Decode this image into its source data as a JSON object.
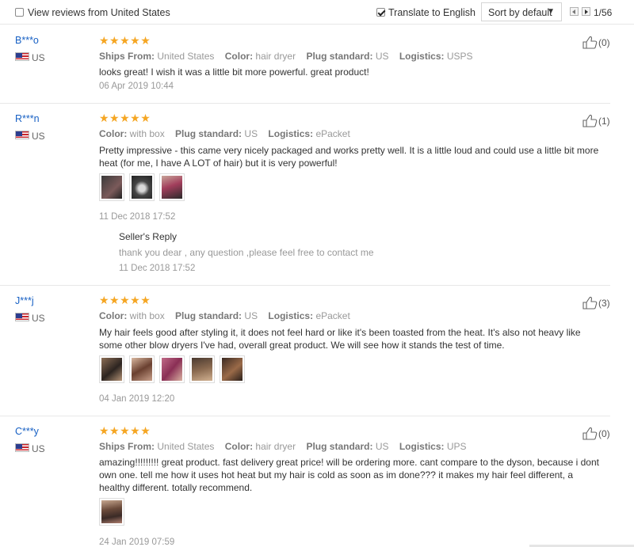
{
  "toolbar": {
    "view_us_label": "View reviews from United States",
    "view_us_checked": false,
    "translate_label": "Translate to English",
    "translate_checked": true,
    "sort_label": "Sort by default",
    "page": "1/56"
  },
  "reviews": [
    {
      "user": "B***o",
      "country": "US",
      "stars": "★★★★★",
      "attrs": [
        {
          "k": "Ships From:",
          "v": "United States"
        },
        {
          "k": "Color:",
          "v": "hair dryer"
        },
        {
          "k": "Plug standard:",
          "v": "US"
        },
        {
          "k": "Logistics:",
          "v": "USPS"
        }
      ],
      "content": "looks great! I wish it was a little bit more powerful. great product!",
      "date": "06 Apr 2019 10:44",
      "likes": "(0)"
    },
    {
      "user": "R***n",
      "country": "US",
      "stars": "★★★★★",
      "attrs": [
        {
          "k": "Color:",
          "v": "with box"
        },
        {
          "k": "Plug standard:",
          "v": "US"
        },
        {
          "k": "Logistics:",
          "v": "ePacket"
        }
      ],
      "content": "Pretty impressive - this came very nicely packaged and works pretty well. It is a little loud and could use a little bit more heat (for me, I have A LOT of hair) but it is very powerful!",
      "date": "11 Dec 2018 17:52",
      "likes": "(1)",
      "reply": {
        "title": "Seller's Reply",
        "text": "thank you dear , any question ,please feel free to contact me",
        "date": "11 Dec 2018 17:52"
      }
    },
    {
      "user": "J***j",
      "country": "US",
      "stars": "★★★★★",
      "attrs": [
        {
          "k": "Color:",
          "v": "with box"
        },
        {
          "k": "Plug standard:",
          "v": "US"
        },
        {
          "k": "Logistics:",
          "v": "ePacket"
        }
      ],
      "content": "My hair feels good after styling it, it does not feel hard or like it's been toasted from the heat. It's also not heavy like some other blow dryers I've had, overall great product. We will see how it stands the test of time.",
      "date": "04 Jan 2019 12:20",
      "likes": "(3)"
    },
    {
      "user": "C***y",
      "country": "US",
      "stars": "★★★★★",
      "attrs": [
        {
          "k": "Ships From:",
          "v": "United States"
        },
        {
          "k": "Color:",
          "v": "hair dryer"
        },
        {
          "k": "Plug standard:",
          "v": "US"
        },
        {
          "k": "Logistics:",
          "v": "UPS"
        }
      ],
      "content": "amazing!!!!!!!!! great product. fast delivery great price! will be ordering more. cant compare to the dyson, because i dont own one. tell me how it uses hot heat but my hair is cold as soon as im done??? it makes my hair feel different, a healthy different. totally recommend.",
      "date": "24 Jan 2019 07:59",
      "likes": "(0)"
    }
  ],
  "colors": {
    "username": "#1760c4",
    "stars": "#f5a623",
    "muted": "#999999"
  }
}
